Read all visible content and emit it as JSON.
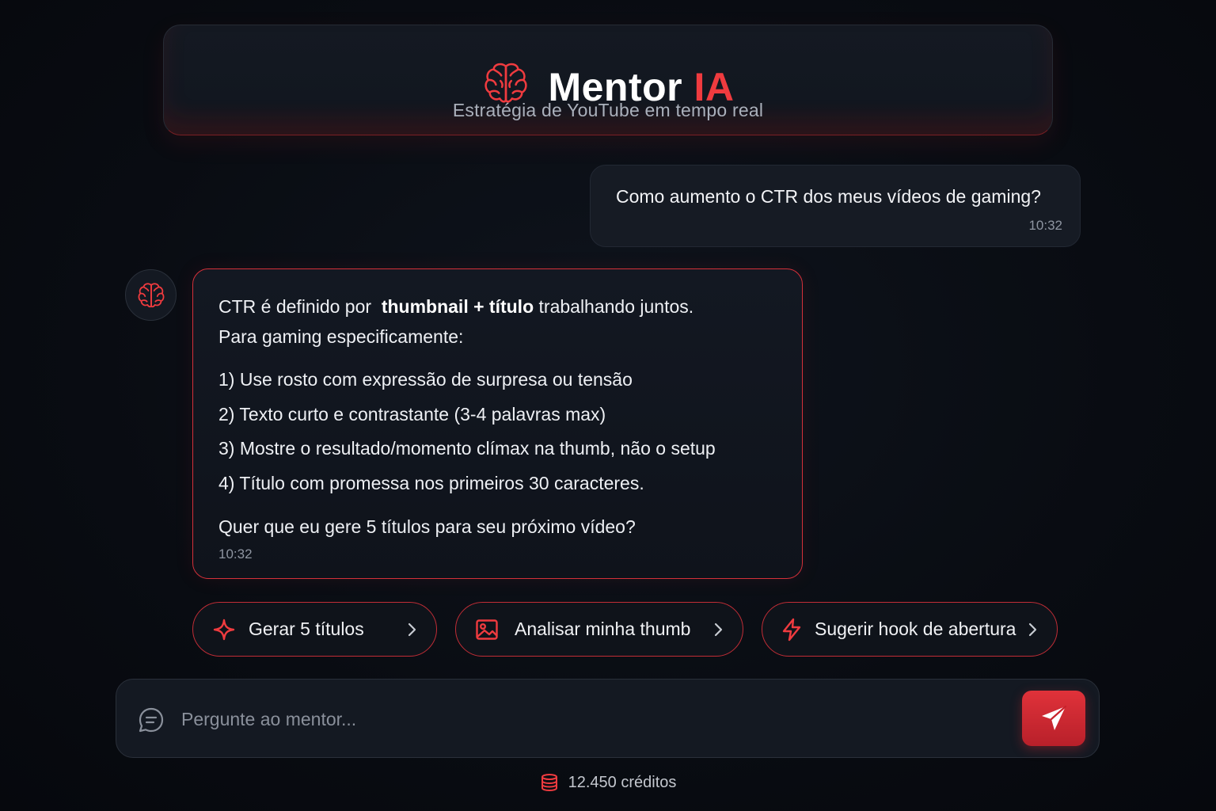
{
  "header": {
    "title_main": "Mentor",
    "title_accent": "IA",
    "subtitle": "Estratégia de YouTube em tempo real",
    "logo_icon": "brain-icon"
  },
  "colors": {
    "accent": "#ef3b3f",
    "background": "#080b11",
    "card": "#141922"
  },
  "messages": {
    "user": {
      "text": "Como aumento o CTR dos meus vídeos de gaming?",
      "time": "10:32"
    },
    "bot": {
      "intro_prefix": "CTR é definido por",
      "intro_bold": "thumbnail + título",
      "intro_suffix": "trabalhando juntos.",
      "intro_line2": "Para gaming especificamente:",
      "items": [
        "1) Use rosto com expressão de surpresa ou tensão",
        "2) Texto curto e contrastante (3-4 palavras max)",
        "3) Mostre o resultado/momento clímax na thumb, não o setup",
        "4) Título com promessa nos primeiros 30 caracteres."
      ],
      "question": "Quer que eu gere 5 títulos para seu próximo vídeo?",
      "time": "10:32"
    }
  },
  "suggestions": [
    {
      "label": "Gerar 5 títulos",
      "icon": "sparkle-icon"
    },
    {
      "label": "Analisar minha thumb",
      "icon": "image-icon"
    },
    {
      "label": "Sugerir hook de abertura",
      "icon": "lightning-icon"
    }
  ],
  "input": {
    "placeholder": "Pergunte ao mentor...",
    "value": ""
  },
  "credits": {
    "text": "12.450 créditos",
    "icon": "database-icon"
  }
}
